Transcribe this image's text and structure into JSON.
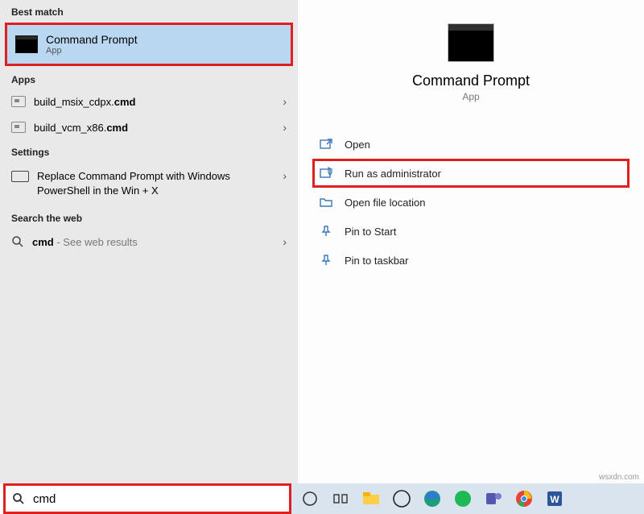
{
  "sections": {
    "best_match": "Best match",
    "apps": "Apps",
    "settings": "Settings",
    "web": "Search the web"
  },
  "best_match_item": {
    "title": "Command Prompt",
    "subtitle": "App"
  },
  "app_items": [
    {
      "prefix": "build_msix_cdpx.",
      "bold": "cmd"
    },
    {
      "prefix": "build_vcm_x86.",
      "bold": "cmd"
    }
  ],
  "settings_item": {
    "text": "Replace Command Prompt with Windows PowerShell in the Win + X"
  },
  "web_item": {
    "bold": "cmd",
    "hint": " - See web results"
  },
  "details": {
    "title": "Command Prompt",
    "subtitle": "App",
    "actions": {
      "open": "Open",
      "run_admin": "Run as administrator",
      "open_loc": "Open file location",
      "pin_start": "Pin to Start",
      "pin_taskbar": "Pin to taskbar"
    }
  },
  "search": {
    "value": "cmd"
  },
  "watermark": "wsxdn.com"
}
